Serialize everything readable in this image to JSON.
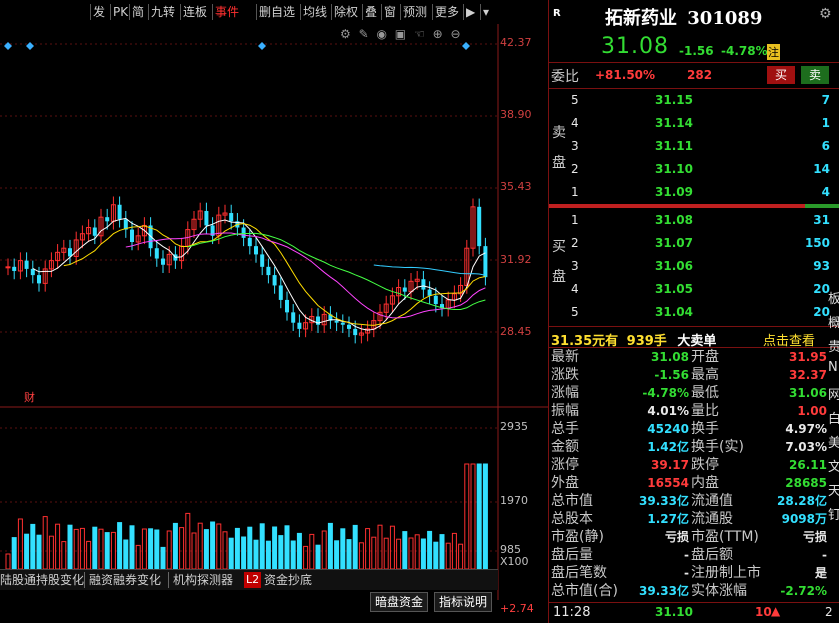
{
  "toolbar": {
    "items": [
      "发",
      "PK",
      "简",
      "九转",
      "连板",
      "事件",
      "删自选",
      "均线",
      "除权",
      "叠",
      "窗",
      "预测",
      "更多"
    ],
    "more_icon": "triangle-down-icon"
  },
  "chart": {
    "price_ticks": [
      "42.37",
      "38.90",
      "35.43",
      "31.92",
      "28.45"
    ],
    "volume_ticks": [
      "2935",
      "1970",
      "985",
      "X100"
    ],
    "bottom_value": "+2.74",
    "finance_marker": "财",
    "tools": [
      "settings-icon",
      "pen-icon",
      "eye-icon",
      "briefcase-icon",
      "hand-icon",
      "zoom-in-icon",
      "zoom-out-icon"
    ]
  },
  "tabs": {
    "items": [
      "陆股通持股变化",
      "融资融券变化",
      "机构探测器",
      "L2",
      "资金抄底"
    ]
  },
  "buttons": {
    "fund": "暗盘资金",
    "guide": "指标说明"
  },
  "stock": {
    "logo": "R",
    "name": "拓新药业",
    "code": "301089",
    "price": "31.08",
    "change": "-1.56",
    "change_pct": "-4.78%",
    "badge": "注",
    "ratio_label": "委比",
    "ratio_value": "+81.50%",
    "ratio_diff": "282",
    "buy_btn": "买",
    "sell_btn": "卖"
  },
  "sell_orders": {
    "side_label": [
      "卖",
      "盘"
    ],
    "rows": [
      {
        "level": "5",
        "price": "31.15",
        "vol": "7"
      },
      {
        "level": "4",
        "price": "31.14",
        "vol": "1"
      },
      {
        "level": "3",
        "price": "31.11",
        "vol": "6"
      },
      {
        "level": "2",
        "price": "31.10",
        "vol": "14"
      },
      {
        "level": "1",
        "price": "31.09",
        "vol": "4"
      }
    ]
  },
  "buy_orders": {
    "side_label": [
      "买",
      "盘"
    ],
    "rows": [
      {
        "level": "1",
        "price": "31.08",
        "vol": "31"
      },
      {
        "level": "2",
        "price": "31.07",
        "vol": "150"
      },
      {
        "level": "3",
        "price": "31.06",
        "vol": "93"
      },
      {
        "level": "4",
        "price": "31.05",
        "vol": "20"
      },
      {
        "level": "5",
        "price": "31.04",
        "vol": "20"
      }
    ]
  },
  "big_order": {
    "price": "31.35元有",
    "qty": "939手",
    "label": "大卖单",
    "link": "点击查看"
  },
  "stats": [
    {
      "l1": "最新",
      "v1": "31.08",
      "c1": "green",
      "l2": "开盘",
      "v2": "31.95",
      "c2": "red"
    },
    {
      "l1": "涨跌",
      "v1": "-1.56",
      "c1": "green",
      "l2": "最高",
      "v2": "32.37",
      "c2": "red"
    },
    {
      "l1": "涨幅",
      "v1": "-4.78%",
      "c1": "green",
      "l2": "最低",
      "v2": "31.06",
      "c2": "green"
    },
    {
      "l1": "振幅",
      "v1": "4.01%",
      "c1": "white",
      "l2": "量比",
      "v2": "1.00",
      "c2": "red"
    },
    {
      "l1": "总手",
      "v1": "45240",
      "c1": "cyan",
      "l2": "换手",
      "v2": "4.97%",
      "c2": "white"
    },
    {
      "l1": "金额",
      "v1": "1.42亿",
      "c1": "cyan",
      "l2": "换手(实)",
      "v2": "7.03%",
      "c2": "white"
    },
    {
      "l1": "涨停",
      "v1": "39.17",
      "c1": "red",
      "l2": "跌停",
      "v2": "26.11",
      "c2": "green"
    },
    {
      "l1": "外盘",
      "v1": "16554",
      "c1": "red",
      "l2": "内盘",
      "v2": "28685",
      "c2": "green"
    },
    {
      "l1": "总市值",
      "v1": "39.33亿",
      "c1": "cyan",
      "l2": "流通值",
      "v2": "28.28亿",
      "c2": "cyan"
    },
    {
      "l1": "总股本",
      "v1": "1.27亿",
      "c1": "cyan",
      "l2": "流通股",
      "v2": "9098万",
      "c2": "cyan"
    },
    {
      "l1": "市盈(静)",
      "v1": "亏损",
      "c1": "white",
      "l2": "市盈(TTM)",
      "v2": "亏损",
      "c2": "white"
    },
    {
      "l1": "盘后量",
      "v1": "-",
      "c1": "white",
      "l2": "盘后额",
      "v2": "-",
      "c2": "white"
    },
    {
      "l1": "盘后笔数",
      "v1": "-",
      "c1": "white",
      "l2": "注册制上市",
      "v2": "是",
      "c2": "white"
    },
    {
      "l1": "总市值(合)",
      "v1": "39.33亿",
      "c1": "cyan",
      "l2": "实体涨幅",
      "v2": "-2.72%",
      "c2": "green"
    }
  ],
  "trade": {
    "time": "11:28",
    "price": "31.10",
    "vol": "10",
    "extra": "2"
  },
  "edge_chars": [
    "板",
    "概",
    "贵",
    "N",
    "网",
    "白",
    "美",
    "文",
    "天",
    "钉"
  ]
}
